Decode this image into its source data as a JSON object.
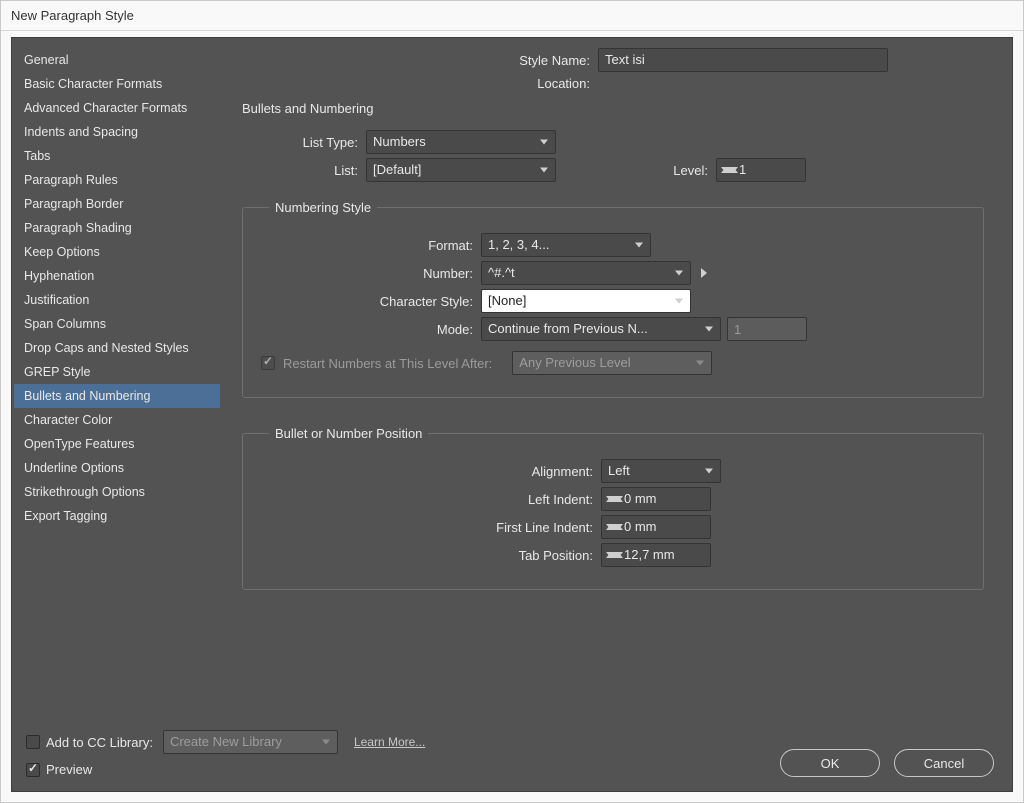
{
  "window": {
    "title": "New Paragraph Style"
  },
  "sidebar": {
    "items": [
      "General",
      "Basic Character Formats",
      "Advanced Character Formats",
      "Indents and Spacing",
      "Tabs",
      "Paragraph Rules",
      "Paragraph Border",
      "Paragraph Shading",
      "Keep Options",
      "Hyphenation",
      "Justification",
      "Span Columns",
      "Drop Caps and Nested Styles",
      "GREP Style",
      "Bullets and Numbering",
      "Character Color",
      "OpenType Features",
      "Underline Options",
      "Strikethrough Options",
      "Export Tagging"
    ],
    "selected_index": 14
  },
  "header": {
    "style_name_label": "Style Name:",
    "style_name_value": "Text isi",
    "location_label": "Location:"
  },
  "section": {
    "heading": "Bullets and Numbering"
  },
  "list_block": {
    "list_type_label": "List Type:",
    "list_type_value": "Numbers",
    "list_label": "List:",
    "list_value": "[Default]",
    "level_label": "Level:",
    "level_value": "1"
  },
  "numbering_style": {
    "legend": "Numbering Style",
    "format_label": "Format:",
    "format_value": "1, 2, 3, 4...",
    "number_label": "Number:",
    "number_value": "^#.^t",
    "char_style_label": "Character Style:",
    "char_style_value": "[None]",
    "mode_label": "Mode:",
    "mode_value": "Continue from Previous N...",
    "mode_after_value": "1",
    "restart_label": "Restart Numbers at This Level After:",
    "restart_value": "Any Previous Level"
  },
  "position": {
    "legend": "Bullet or Number Position",
    "alignment_label": "Alignment:",
    "alignment_value": "Left",
    "left_indent_label": "Left Indent:",
    "left_indent_value": "0 mm",
    "first_line_indent_label": "First Line Indent:",
    "first_line_indent_value": "0 mm",
    "tab_position_label": "Tab Position:",
    "tab_position_value": "12,7 mm"
  },
  "footer": {
    "add_library_label": "Add to CC Library:",
    "library_select_value": "Create New Library",
    "learn_more": "Learn More...",
    "preview_label": "Preview",
    "ok": "OK",
    "cancel": "Cancel"
  }
}
